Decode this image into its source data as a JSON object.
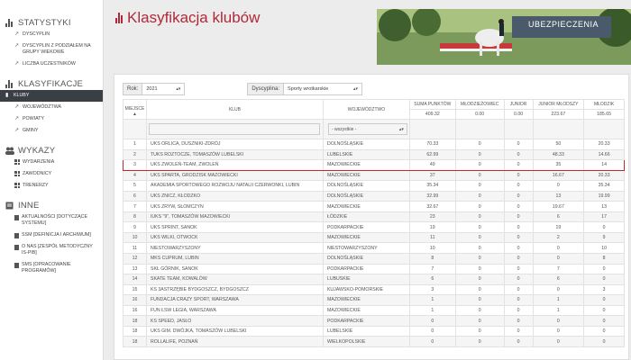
{
  "sidebar": {
    "sections": [
      {
        "title": "STATYSTYKI",
        "icon": "bar-chart-icon",
        "items": [
          {
            "label": "DYSCYPLIN"
          },
          {
            "label": "DYSCYPLIN Z PODZIAŁEM NA GRUPY WIEKOWE"
          },
          {
            "label": "LICZBA UCZESTNIKÓW"
          }
        ]
      },
      {
        "title": "KLASYFIKACJE",
        "icon": "bar-chart-icon",
        "items": [
          {
            "label": "KLUBY",
            "active": true
          },
          {
            "label": "WOJEWÓDZTWA"
          },
          {
            "label": "POWIATY"
          },
          {
            "label": "GMINY"
          }
        ]
      },
      {
        "title": "WYKAZY",
        "icon": "people-icon",
        "items": [
          {
            "label": "WYDARZENIA"
          },
          {
            "label": "ZAWODNICY"
          },
          {
            "label": "TRENERZY"
          }
        ]
      },
      {
        "title": "INNE",
        "icon": "document-icon",
        "items": [
          {
            "label": "AKTUALNOŚCI [DOTYCZĄCE SYSTEMU]"
          },
          {
            "label": "SSM [DEFINICJA I ARCHIWUM]"
          },
          {
            "label": "O NAS [ZESPÓŁ METODYCZNY IS-PIB]"
          },
          {
            "label": "SMS [OPRACOWANIE PROGRAMÓW]"
          }
        ]
      }
    ]
  },
  "header": {
    "title": "Klasyfikacja klubów",
    "banner_text": "UBEZPIECZENIA"
  },
  "filters": {
    "year_label": "Rok:",
    "year_value": "2021",
    "discipline_label": "Dyscyplina:",
    "discipline_value": "Sporty wrotkarskie"
  },
  "table": {
    "headers": {
      "place": "MIEJSCE",
      "club": "KLUB",
      "voiv": "WOJEWÓDZTWO",
      "sum": "SUMA PUNKTÓW",
      "youth": "MŁODZIEŻOWIEC",
      "junior": "JUNIOR",
      "junior_mlodszy": "JUNIOR MŁODSZY",
      "mlodzik": "MŁODZIK"
    },
    "sort_indicator": "▲",
    "totals": {
      "sum": "409.32",
      "youth": "0.00",
      "junior": "0.00",
      "junior_mlodszy": "223.67",
      "mlodzik": "185.65"
    },
    "voiv_filter": "- wszystkie -",
    "rows": [
      [
        "1",
        "UKS ORLICA, DUSZNIKI-ZDRÓJ",
        "DOLNOŚLĄSKIE",
        "70.33",
        "0",
        "0",
        "50",
        "20.33"
      ],
      [
        "2",
        "TUKS ROZTOCZE, TOMASZÓW LUBELSKI",
        "LUBELSKIE",
        "62.99",
        "0",
        "0",
        "48.33",
        "14.66"
      ],
      [
        "3",
        "UKS ZWOLEŃ-TEAM, ZWOLEŃ",
        "MAZOWIECKIE",
        "49",
        "0",
        "0",
        "35",
        "14"
      ],
      [
        "4",
        "UKS SPARTA, GRODZISK MAZOWIECKI",
        "MAZOWIECKIE",
        "37",
        "0",
        "0",
        "16.67",
        "20.33"
      ],
      [
        "5",
        "AKADEMIA SPORTOWEGO ROZWOJU NATALII CZERWONKI, LUBIN",
        "DOLNOŚLĄSKIE",
        "35.34",
        "0",
        "0",
        "0",
        "35.34"
      ],
      [
        "6",
        "UKS ZNICZ, KŁODZKO",
        "DOLNOŚLĄSKIE",
        "32.99",
        "0",
        "0",
        "13",
        "19.99"
      ],
      [
        "7",
        "UKS ZRYW, SŁOMCZYN",
        "MAZOWIECKIE",
        "32.67",
        "0",
        "0",
        "19.67",
        "13"
      ],
      [
        "8",
        "IUKS \"9\", TOMASZÓW MAZOWIECKI",
        "ŁÓDZKIE",
        "23",
        "0",
        "0",
        "6",
        "17"
      ],
      [
        "9",
        "UKS SPRINT, SANOK",
        "PODKARPACKIE",
        "19",
        "0",
        "0",
        "19",
        "0"
      ],
      [
        "10",
        "UKS WILKI, OTWOCK",
        "MAZOWIECKIE",
        "11",
        "0",
        "0",
        "2",
        "9"
      ],
      [
        "11",
        "NIESTOWARZYSZONY",
        "NIESTOWARZYSZONY",
        "10",
        "0",
        "0",
        "0",
        "10"
      ],
      [
        "12",
        "MKS CUPRUM, LUBIN",
        "DOLNOŚLĄSKIE",
        "8",
        "0",
        "0",
        "0",
        "8"
      ],
      [
        "13",
        "SKŁ GÓRNIK, SANOK",
        "PODKARPACKIE",
        "7",
        "0",
        "0",
        "7",
        "0"
      ],
      [
        "14",
        "SKATE TEAM, KOWALÓW",
        "LUBUSKIE",
        "6",
        "0",
        "0",
        "6",
        "0"
      ],
      [
        "15",
        "KS 3ASTRZĘBIE BYDGOSZCZ, BYDGOSZCZ",
        "KUJAWSKO-POMORSKIE",
        "3",
        "0",
        "0",
        "0",
        "3"
      ],
      [
        "16",
        "FUNDACJA CRAZY SPORT, WARSZAWA",
        "MAZOWIECKIE",
        "1",
        "0",
        "0",
        "1",
        "0"
      ],
      [
        "16",
        "FUN ŁSW LEGIA, WARSZAWA",
        "MAZOWIECKIE",
        "1",
        "0",
        "0",
        "1",
        "0"
      ],
      [
        "18",
        "KS SPEED, JASŁO",
        "PODKARPACKIE",
        "0",
        "0",
        "0",
        "0",
        "0"
      ],
      [
        "18",
        "UKS GIM. DWÓJKA, TOMASZÓW LUBELSKI",
        "LUBELSKIE",
        "0",
        "0",
        "0",
        "0",
        "0"
      ],
      [
        "18",
        "ROLLALIFE, POZNAŃ",
        "WIELKOPOLSKIE",
        "0",
        "0",
        "0",
        "0",
        "0"
      ]
    ],
    "highlight_row": 2
  }
}
